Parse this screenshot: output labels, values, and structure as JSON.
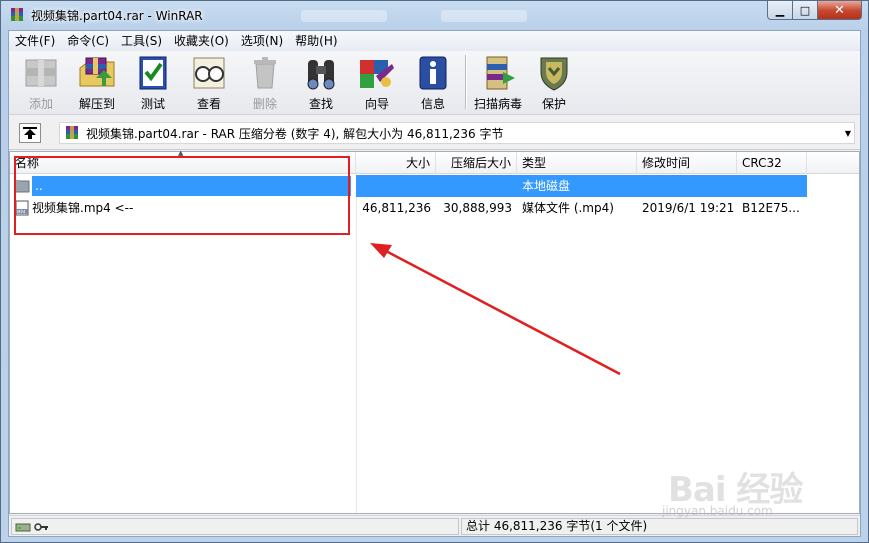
{
  "window": {
    "title": "视频集锦.part04.rar - WinRAR",
    "minimize": "▁",
    "maximize": "□",
    "close": "✕"
  },
  "menu": [
    "文件(F)",
    "命令(C)",
    "工具(S)",
    "收藏夹(O)",
    "选项(N)",
    "帮助(H)"
  ],
  "toolbar": [
    {
      "label": "添加",
      "icon": "add-icon",
      "disabled": true
    },
    {
      "label": "解压到",
      "icon": "extract-icon",
      "disabled": false
    },
    {
      "label": "测试",
      "icon": "test-icon",
      "disabled": false
    },
    {
      "label": "查看",
      "icon": "view-icon",
      "disabled": false
    },
    {
      "label": "删除",
      "icon": "delete-icon",
      "disabled": true
    },
    {
      "label": "查找",
      "icon": "find-icon",
      "disabled": false
    },
    {
      "label": "向导",
      "icon": "wizard-icon",
      "disabled": false
    },
    {
      "label": "信息",
      "icon": "info-icon",
      "disabled": false
    },
    {
      "label": "扫描病毒",
      "icon": "scan-virus-icon",
      "disabled": false
    },
    {
      "label": "保护",
      "icon": "protect-icon",
      "disabled": false
    }
  ],
  "address": {
    "text": "视频集锦.part04.rar - RAR 压缩分卷 (数字 4), 解包大小为 46,811,236 字节"
  },
  "columns": [
    "名称",
    "大小",
    "压缩后大小",
    "类型",
    "修改时间",
    "CRC32"
  ],
  "rows": [
    {
      "name": "..",
      "size": "",
      "packed": "",
      "type": "本地磁盘",
      "modified": "",
      "crc": "",
      "selected": true
    },
    {
      "name": "视频集锦.mp4 <--",
      "size": "46,811,236",
      "packed": "30,888,993",
      "type": "媒体文件 (.mp4)",
      "modified": "2019/6/1 19:21",
      "crc": "B12E75...",
      "selected": false
    }
  ],
  "status": {
    "summary": "总计 46,811,236 字节(1 个文件)"
  },
  "watermark": {
    "brand": "Bai 经验",
    "url": "jingyan.baidu.com"
  },
  "colors": {
    "selection": "#3399ff",
    "annotation": "#e02020"
  }
}
